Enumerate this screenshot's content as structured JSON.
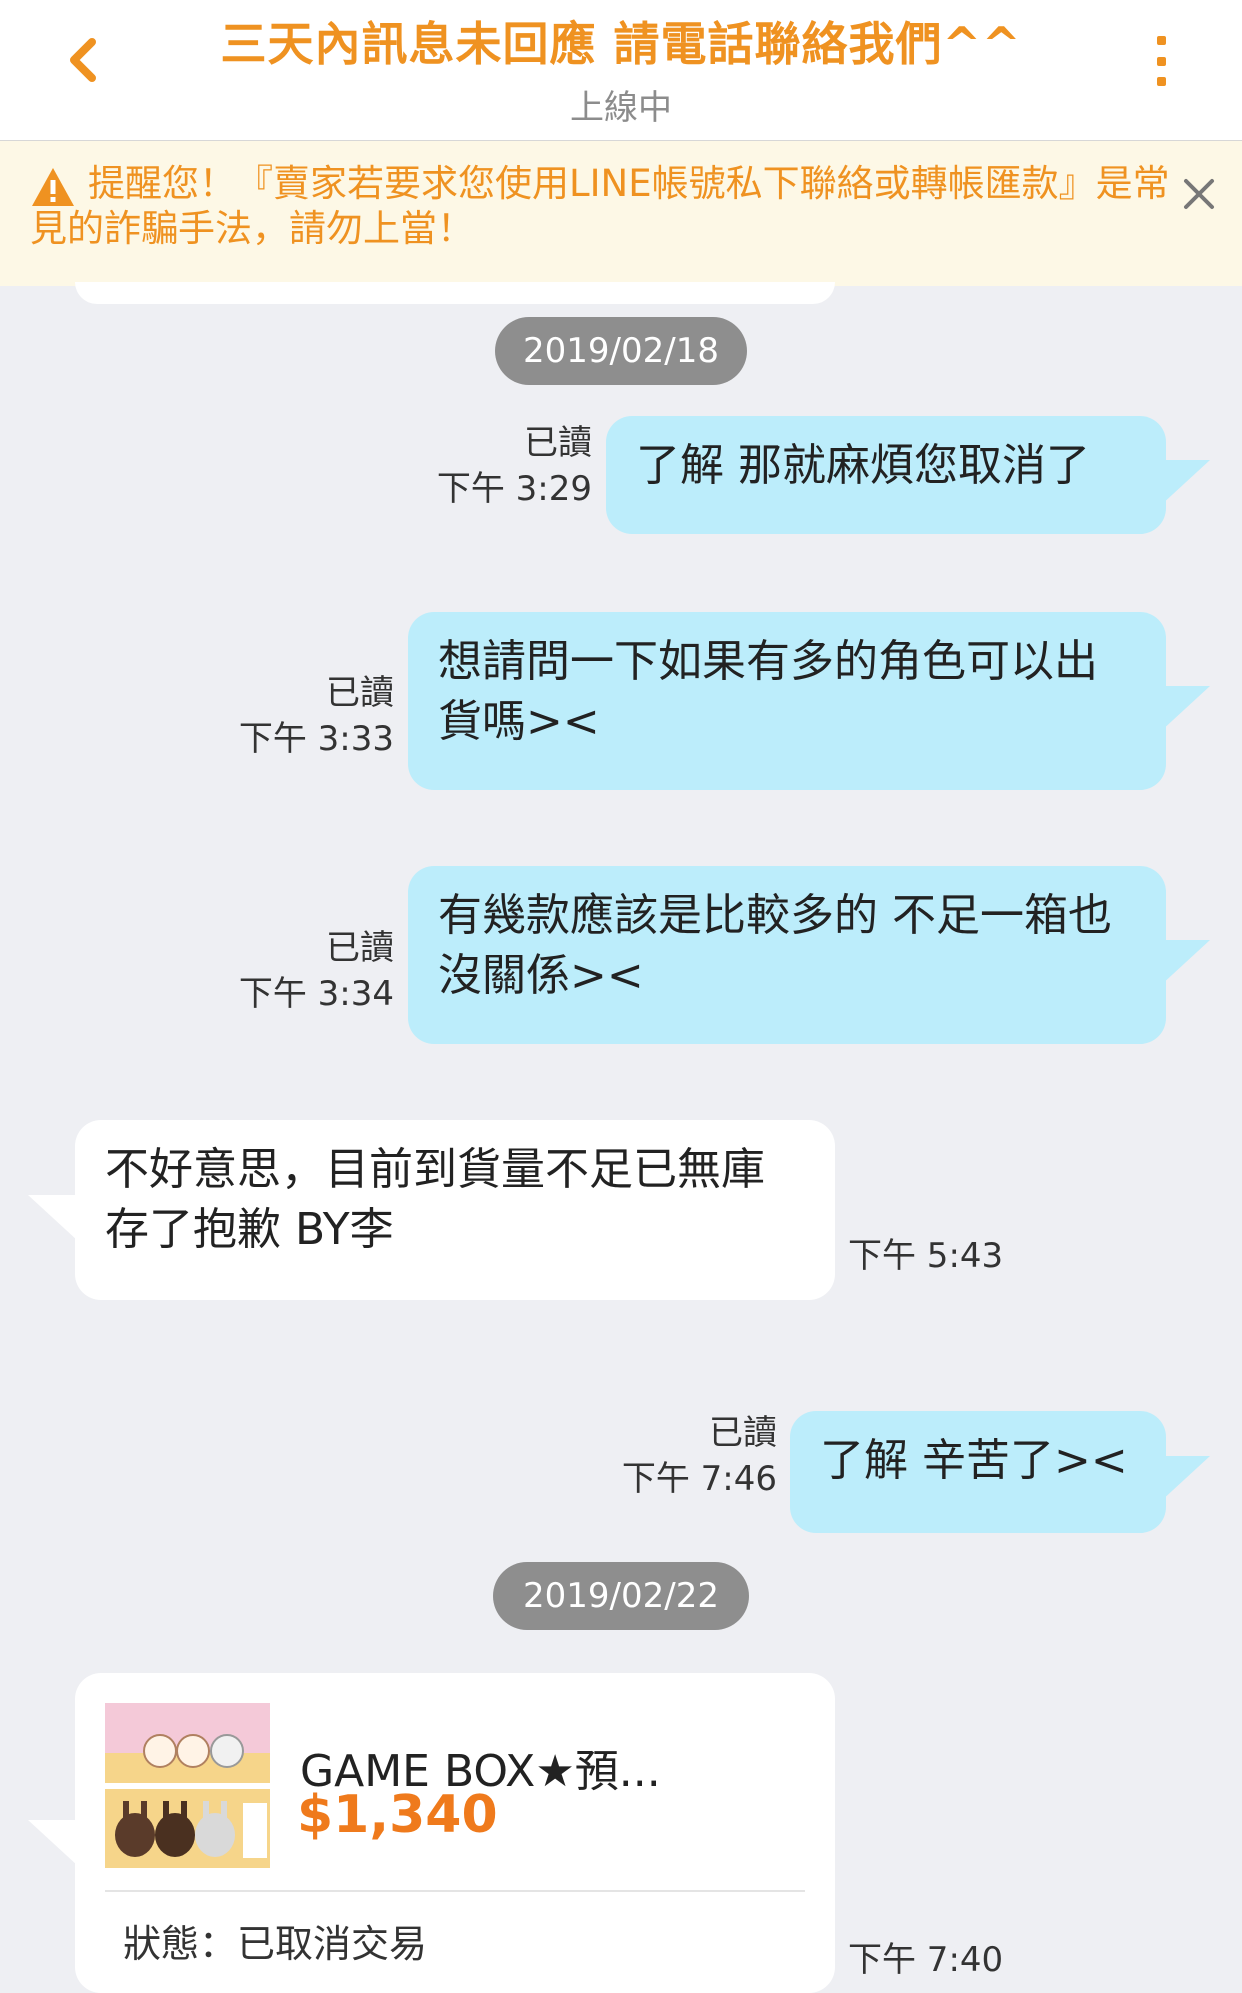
{
  "header": {
    "title": "三天內訊息未回應 請電話聯絡我們^^",
    "status": "上線中"
  },
  "warning": {
    "text": "提醒您！『賣家若要求您使用LINE帳號私下聯絡或轉帳匯款』是常見的詐騙手法，請勿上當！"
  },
  "colors": {
    "accent": "#ef9221",
    "outgoing_bubble": "#bcedfb",
    "incoming_bubble": "#ffffff",
    "background": "#eeeff3",
    "price": "#ef7a1c"
  },
  "messages": {
    "date1": "2019/02/18",
    "m1": {
      "text": "了解 那就麻煩您取消了",
      "read": "已讀",
      "time": "下午 3:29"
    },
    "m2": {
      "text": "想請問一下如果有多的角色可以出貨嗎><",
      "read": "已讀",
      "time": "下午 3:33"
    },
    "m3": {
      "text": "有幾款應該是比較多的 不足一箱也沒關係><",
      "read": "已讀",
      "time": "下午 3:34"
    },
    "m4": {
      "text": "不好意思，目前到貨量不足已無庫存了抱歉 BY李",
      "time": "下午 5:43"
    },
    "m5": {
      "text": "了解 辛苦了><",
      "read": "已讀",
      "time": "下午 7:46"
    },
    "date2": "2019/02/22",
    "product": {
      "name": "GAME BOX★預...",
      "price": "$1,340",
      "status": "狀態：已取消交易",
      "time": "下午 7:40"
    }
  }
}
